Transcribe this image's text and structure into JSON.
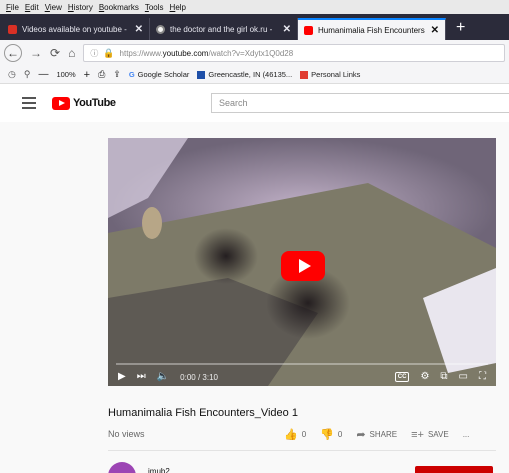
{
  "menubar": {
    "items": [
      "File",
      "Edit",
      "View",
      "History",
      "Bookmarks",
      "Tools",
      "Help"
    ]
  },
  "tabs": [
    {
      "label": "Videos available on youtube - ",
      "active": false,
      "favicon": "gmail-icon"
    },
    {
      "label": "the doctor and the girl ok.ru - ",
      "active": false,
      "favicon": "ok-icon"
    },
    {
      "label": "Humanimalia Fish Encounters",
      "active": true,
      "favicon": "youtube-icon"
    }
  ],
  "nav": {
    "url_prefix": "https://www.",
    "url_domain": "youtube.com",
    "url_rest": "/watch?v=Xdytx1Q0d28"
  },
  "bookmarks": {
    "zoom": "100%",
    "items": [
      {
        "label": "Google Scholar",
        "icon": "google-icon"
      },
      {
        "label": "Greencastle, IN (46135...",
        "icon": "weather-icon"
      },
      {
        "label": "Personal Links",
        "icon": "folder-icon"
      }
    ]
  },
  "youtube": {
    "logo_text": "YouTube",
    "search_placeholder": "Search"
  },
  "player": {
    "time": "0:00 / 3:10",
    "cc_label": "CC",
    "progress": 0
  },
  "video": {
    "title": "Humanimalia Fish Encounters_Video 1",
    "views": "No views",
    "likes": "0",
    "dislikes": "0",
    "share_label": "SHARE",
    "save_label": "SAVE",
    "more_label": "..."
  },
  "channel": {
    "name": "jmub2"
  },
  "colors": {
    "youtube_red": "#ff0000",
    "tab_strip": "#2b2b3a",
    "active_tab_accent": "#0a84ff"
  }
}
